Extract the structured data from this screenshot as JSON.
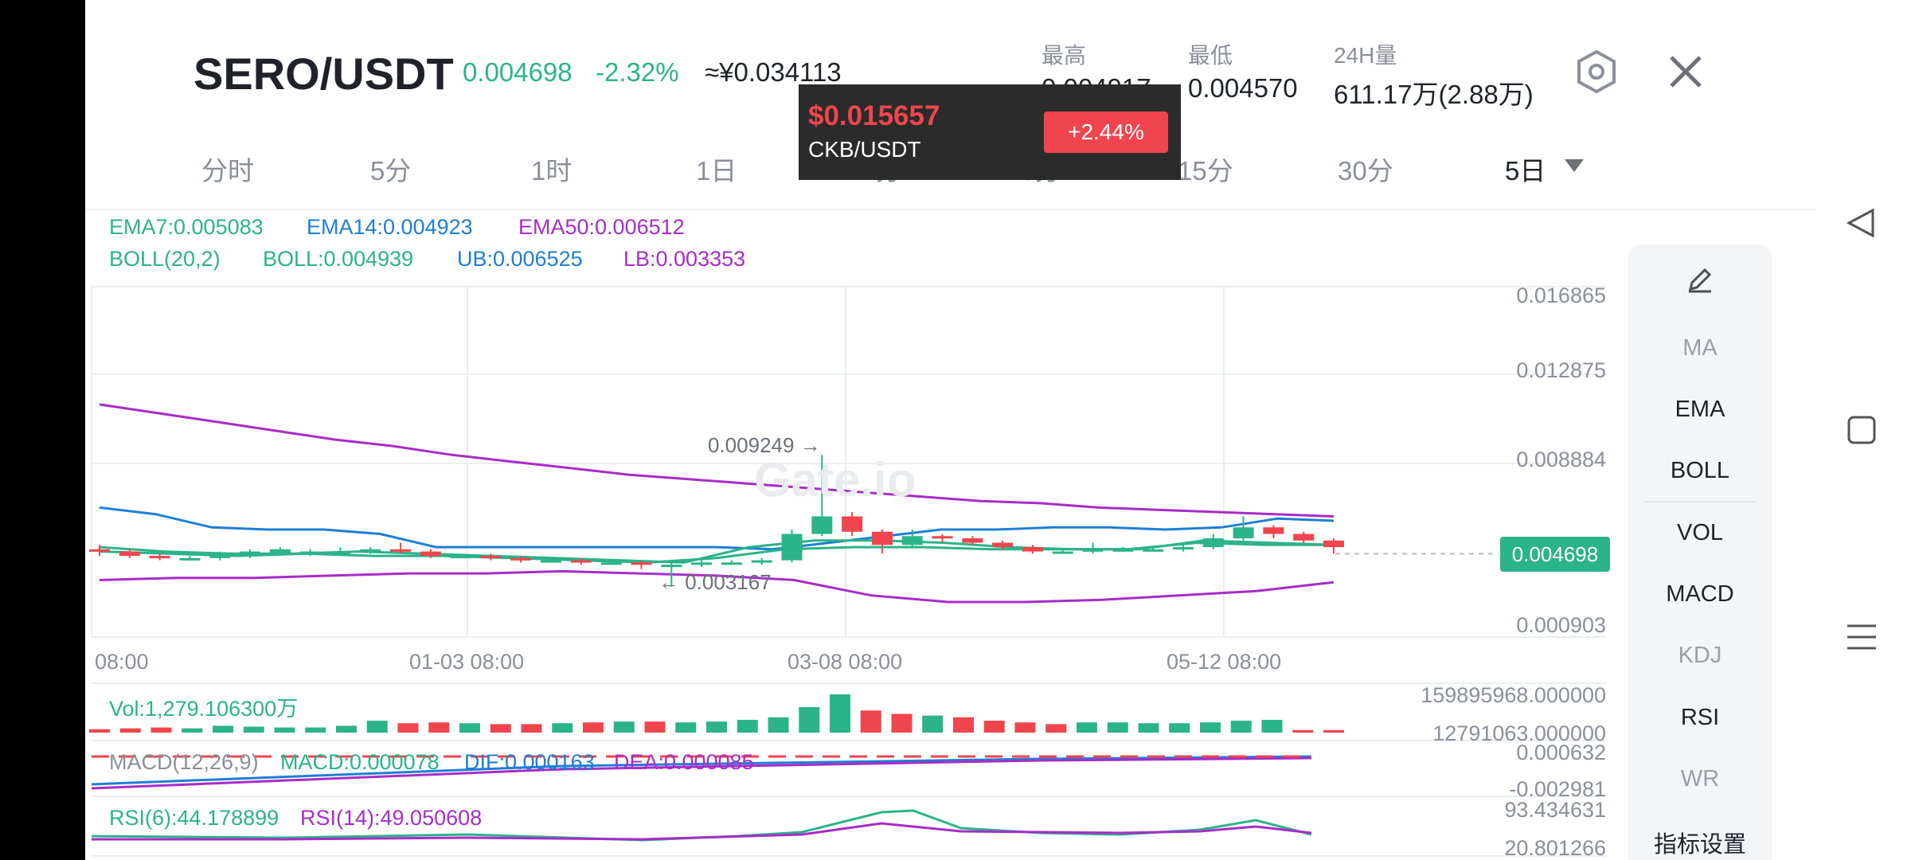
{
  "header": {
    "pair": "SERO/USDT",
    "price": "0.004698",
    "change": "-2.32%",
    "cny": "≈¥0.034113",
    "stats": [
      {
        "label": "最高",
        "value": "0.004917"
      },
      {
        "label": "最低",
        "value": "0.004570"
      },
      {
        "label": "24H量",
        "value": "611.17万(2.88万)"
      }
    ]
  },
  "tabs": [
    "分时",
    "5分",
    "1时",
    "1日",
    "1分",
    "3分",
    "15分",
    "30分",
    "5日"
  ],
  "active_tab": "5日",
  "popup": {
    "price": "$0.015657",
    "symbol": "CKB/USDT",
    "badge": "+2.44%"
  },
  "legend": {
    "ema7": "EMA7:0.005083",
    "ema14": "EMA14:0.004923",
    "ema50": "EMA50:0.006512",
    "boll_params": "BOLL(20,2)",
    "boll": "BOLL:0.004939",
    "ub": "UB:0.006525",
    "lb": "LB:0.003353"
  },
  "price_axis": [
    "0.016865",
    "0.012875",
    "0.008884",
    "0.000903"
  ],
  "current_price_tag": "0.004698",
  "high_marker": "0.009249 →",
  "low_marker": "← 0.003167",
  "time_axis": [
    "08:00",
    "01-03 08:00",
    "03-08 08:00",
    "05-12 08:00"
  ],
  "watermark": "Gate.io",
  "volume": {
    "label": "Vol:1,279.106300万",
    "axis_top": "159895968.000000",
    "axis_bottom": "12791063.000000"
  },
  "macd": {
    "label": "MACD(12,26,9)",
    "macd": "MACD:0.000078",
    "dif": "DIF:0.000163",
    "dea": "DEA:0.000085",
    "axis_top": "0.000632",
    "axis_bottom": "-0.002981"
  },
  "rsi": {
    "rsi6": "RSI(6):44.178899",
    "rsi14": "RSI(14):49.050608",
    "axis_top": "93.434631",
    "axis_bottom": "20.801266"
  },
  "sidebar": [
    "MA",
    "EMA",
    "BOLL",
    "VOL",
    "MACD",
    "KDJ",
    "RSI",
    "WR",
    "指标设置"
  ],
  "sidebar_dim": [
    "MA",
    "KDJ",
    "WR"
  ],
  "colors": {
    "up": "#2bb38a",
    "down": "#f0454d",
    "ema7": "#2bb38a",
    "ema14": "#1d7fd6",
    "ema50": "#a82cc8"
  },
  "chart_data": {
    "type": "candlestick",
    "interval": "5日",
    "ylim": [
      0.000903,
      0.016865
    ],
    "candles": [
      {
        "o": 0.0049,
        "c": 0.0048,
        "h": 0.0051,
        "l": 0.0046
      },
      {
        "o": 0.0048,
        "c": 0.0046,
        "h": 0.0049,
        "l": 0.0045
      },
      {
        "o": 0.0046,
        "c": 0.0045,
        "h": 0.0047,
        "l": 0.0044
      },
      {
        "o": 0.0045,
        "c": 0.0045,
        "h": 0.0046,
        "l": 0.0044
      },
      {
        "o": 0.0045,
        "c": 0.0047,
        "h": 0.0048,
        "l": 0.0044
      },
      {
        "o": 0.0047,
        "c": 0.0048,
        "h": 0.0049,
        "l": 0.0045
      },
      {
        "o": 0.0047,
        "c": 0.0049,
        "h": 0.005,
        "l": 0.0046
      },
      {
        "o": 0.0047,
        "c": 0.0048,
        "h": 0.0049,
        "l": 0.0046
      },
      {
        "o": 0.0048,
        "c": 0.0048,
        "h": 0.005,
        "l": 0.0046
      },
      {
        "o": 0.0048,
        "c": 0.0049,
        "h": 0.005,
        "l": 0.0047
      },
      {
        "o": 0.0049,
        "c": 0.0048,
        "h": 0.0052,
        "l": 0.0047
      },
      {
        "o": 0.0048,
        "c": 0.0046,
        "h": 0.0049,
        "l": 0.0045
      },
      {
        "o": 0.0046,
        "c": 0.0046,
        "h": 0.0047,
        "l": 0.0045
      },
      {
        "o": 0.0046,
        "c": 0.0045,
        "h": 0.0047,
        "l": 0.0044
      },
      {
        "o": 0.0045,
        "c": 0.0044,
        "h": 0.0046,
        "l": 0.0043
      },
      {
        "o": 0.0044,
        "c": 0.0044,
        "h": 0.0045,
        "l": 0.0043
      },
      {
        "o": 0.0044,
        "c": 0.0043,
        "h": 0.0045,
        "l": 0.0042
      },
      {
        "o": 0.0043,
        "c": 0.0043,
        "h": 0.0044,
        "l": 0.0042
      },
      {
        "o": 0.0043,
        "c": 0.0042,
        "h": 0.0044,
        "l": 0.004
      },
      {
        "o": 0.0042,
        "c": 0.0042,
        "h": 0.0043,
        "l": 0.0032
      },
      {
        "o": 0.0042,
        "c": 0.0043,
        "h": 0.0044,
        "l": 0.0041
      },
      {
        "o": 0.0043,
        "c": 0.0043,
        "h": 0.0044,
        "l": 0.0042
      },
      {
        "o": 0.0043,
        "c": 0.0044,
        "h": 0.0045,
        "l": 0.0042
      },
      {
        "o": 0.0044,
        "c": 0.0056,
        "h": 0.0058,
        "l": 0.0043
      },
      {
        "o": 0.0056,
        "c": 0.0064,
        "h": 0.0092,
        "l": 0.0055
      },
      {
        "o": 0.0064,
        "c": 0.0057,
        "h": 0.0066,
        "l": 0.0055
      },
      {
        "o": 0.0057,
        "c": 0.0051,
        "h": 0.0058,
        "l": 0.0047
      },
      {
        "o": 0.0051,
        "c": 0.0055,
        "h": 0.0058,
        "l": 0.005
      },
      {
        "o": 0.0055,
        "c": 0.0054,
        "h": 0.0056,
        "l": 0.0052
      },
      {
        "o": 0.0054,
        "c": 0.0052,
        "h": 0.0055,
        "l": 0.0051
      },
      {
        "o": 0.0052,
        "c": 0.005,
        "h": 0.0053,
        "l": 0.0049
      },
      {
        "o": 0.005,
        "c": 0.0048,
        "h": 0.0051,
        "l": 0.0047
      },
      {
        "o": 0.0048,
        "c": 0.0048,
        "h": 0.0049,
        "l": 0.0047
      },
      {
        "o": 0.0048,
        "c": 0.0049,
        "h": 0.0052,
        "l": 0.0047
      },
      {
        "o": 0.0049,
        "c": 0.0049,
        "h": 0.005,
        "l": 0.0048
      },
      {
        "o": 0.0049,
        "c": 0.0049,
        "h": 0.005,
        "l": 0.0048
      },
      {
        "o": 0.0049,
        "c": 0.005,
        "h": 0.0051,
        "l": 0.0048
      },
      {
        "o": 0.005,
        "c": 0.0054,
        "h": 0.0056,
        "l": 0.0049
      },
      {
        "o": 0.0054,
        "c": 0.0059,
        "h": 0.0064,
        "l": 0.0053
      },
      {
        "o": 0.0059,
        "c": 0.0056,
        "h": 0.006,
        "l": 0.0054
      },
      {
        "o": 0.0056,
        "c": 0.0053,
        "h": 0.0057,
        "l": 0.0052
      },
      {
        "o": 0.0053,
        "c": 0.005,
        "h": 0.0054,
        "l": 0.0047
      }
    ],
    "ema50": [
      0.0115,
      0.0111,
      0.0107,
      0.0103,
      0.0099,
      0.0096,
      0.0092,
      0.0089,
      0.0086,
      0.0083,
      0.0081,
      0.0079,
      0.0077,
      0.0075,
      0.0073,
      0.0071,
      0.007,
      0.0068,
      0.0067,
      0.0066,
      0.0065,
      0.0064
    ],
    "boll_ub": [
      0.0068,
      0.0065,
      0.0059,
      0.0058,
      0.0058,
      0.0056,
      0.005,
      0.005,
      0.005,
      0.005,
      0.005,
      0.005,
      0.0049,
      0.0052,
      0.0055,
      0.0058,
      0.0058,
      0.0059,
      0.0059,
      0.0058,
      0.0059,
      0.0063,
      0.0062
    ],
    "boll_lb": [
      0.0035,
      0.0036,
      0.0036,
      0.0037,
      0.0038,
      0.0038,
      0.0039,
      0.0038,
      0.0037,
      0.0035,
      0.0028,
      0.0025,
      0.0025,
      0.0026,
      0.0028,
      0.003,
      0.0034
    ],
    "ema7": [
      0.005,
      0.0048,
      0.0047,
      0.0047,
      0.0048,
      0.0047,
      0.0046,
      0.0045,
      0.0044,
      0.0043,
      0.005,
      0.0053,
      0.0053,
      0.0052,
      0.005,
      0.0049,
      0.0049,
      0.0053,
      0.0052,
      0.0051
    ],
    "ema14": [
      0.0048,
      0.0047,
      0.0046,
      0.0047,
      0.0046,
      0.0046,
      0.0045,
      0.0044,
      0.0043,
      0.0045,
      0.0049,
      0.005,
      0.005,
      0.0049,
      0.0049,
      0.0049,
      0.0052,
      0.0051,
      0.0051
    ],
    "volume": [
      4,
      5,
      6,
      5,
      8,
      7,
      6,
      6,
      8,
      14,
      11,
      12,
      11,
      10,
      10,
      11,
      12,
      13,
      13,
      12,
      13,
      15,
      18,
      30,
      45,
      26,
      22,
      20,
      18,
      14,
      12,
      10,
      12,
      12,
      11,
      11,
      12,
      14,
      15,
      3,
      3
    ]
  }
}
